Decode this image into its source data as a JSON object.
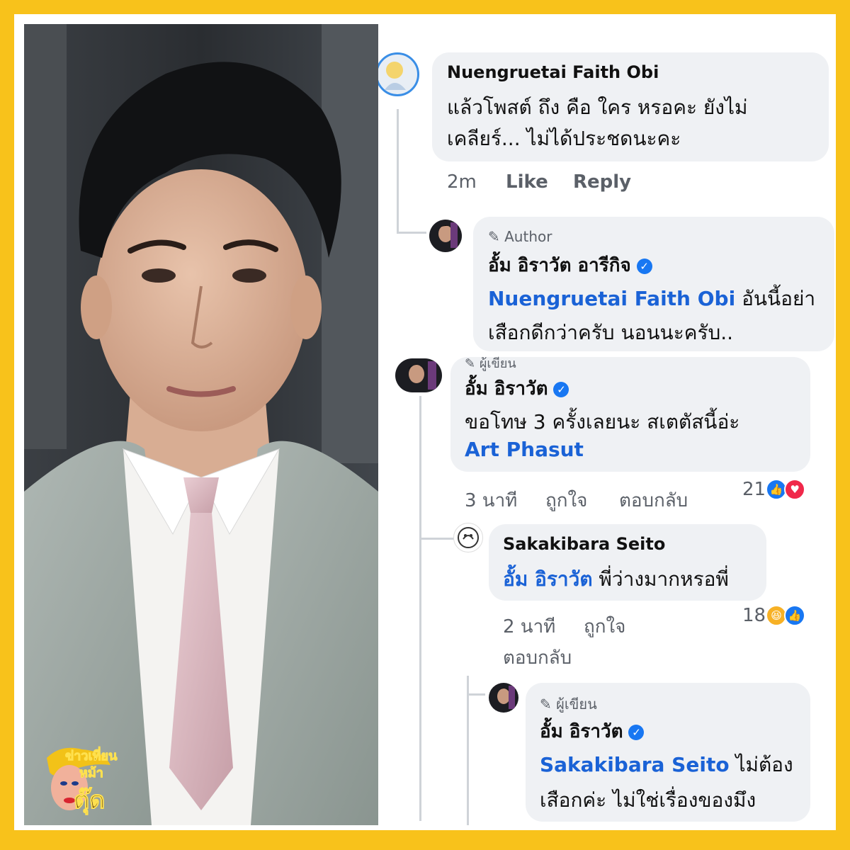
{
  "logo": {
    "line1": "ข่าวเที่ยน",
    "line2": "หม้า",
    "line3": "ตุ๊ด"
  },
  "comments": {
    "c1": {
      "name": "Nuengruetai Faith Obi",
      "text_line1": "แล้วโพสต์ ถึง คือ ใคร หรอคะ ยังไม่",
      "text_line2": "เคลียร์... ไม่ได้ประชดนะคะ",
      "time": "2m",
      "like": "Like",
      "reply": "Reply"
    },
    "c2": {
      "badge": "Author",
      "name": "อั้ม อิราวัต อารีกิจ",
      "mention": "Nuengruetai Faith Obi",
      "text_line1": " อันนี้อย่า",
      "text_line2": "เสือกดีกว่าครับ นอนนะครับ.."
    },
    "c3": {
      "badge": "ผู้เขียน",
      "name": "อั้ม อิราวัต",
      "text_line1": "ขอโทษ 3 ครั้งเลยนะ สเตตัสนี้อ่ะ",
      "mention": "Art Phasut",
      "time": "3 นาที",
      "like": "ถูกใจ",
      "reply": "ตอบกลับ",
      "reactions": "21"
    },
    "c4": {
      "name": "Sakakibara Seito",
      "mention": "อั้ม อิราวัต",
      "text_line1": " พี่ว่างมากหรอพี่",
      "time": "2 นาที",
      "like": "ถูกใจ",
      "reply": "ตอบกลับ",
      "reactions": "18"
    },
    "c5": {
      "badge": "ผู้เขียน",
      "name": "อั้ม อิราวัต",
      "mention": "Sakakibara Seito",
      "text_line1": " ไม่ต้อง",
      "text_line2": "เสือกค่ะ ไม่ใช่เรื่องของมึง"
    }
  },
  "colors": {
    "frame": "#f8c21b",
    "mention": "#1a62d6",
    "bubble": "#eff1f4",
    "verified": "#1877f2"
  }
}
